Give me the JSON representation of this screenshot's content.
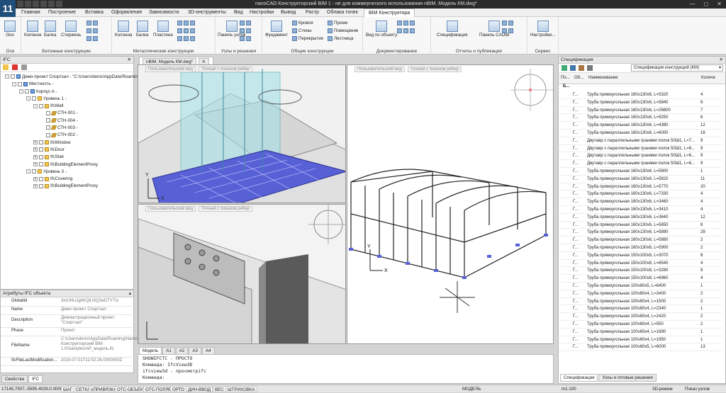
{
  "app_title": "nanoCAD Конструкторский BIM 1 - не для коммерческого использования nBIM. Модель КМ.dwg*",
  "logo": "11",
  "menu": [
    "Главная",
    "Построение",
    "Вставка",
    "Оформление",
    "Зависимости",
    "3D-инструменты",
    "Вид",
    "Настройки",
    "Вывод",
    "Растр",
    "Облака точек",
    "BIM Конструктора"
  ],
  "ribbon": {
    "groups": [
      {
        "label": "Оси",
        "buttons": [
          "Оси"
        ]
      },
      {
        "label": "Бетонные конструкции",
        "buttons": [
          "Колонна",
          "Балка",
          "Стержень"
        ]
      },
      {
        "label": "Металлические конструкции",
        "buttons": [
          "Колонна",
          "Балка",
          "Пластина"
        ]
      },
      {
        "label": "Узлы и решения",
        "buttons": [
          "Панель узлов"
        ]
      },
      {
        "label": "Общие конструкции",
        "buttons": [
          "Фундамент",
          "Кровля",
          "Стены",
          "Перекрытие",
          "Проем",
          "Помещение",
          "Лестница"
        ]
      },
      {
        "label": "Документирование",
        "buttons": [
          "Вид по объекту"
        ]
      },
      {
        "label": "Отчеты и публикация",
        "buttons": [
          "Спецификация",
          "Панель CADlib"
        ]
      },
      {
        "label": "Сервис",
        "buttons": [
          "Настройки..."
        ]
      }
    ]
  },
  "ifc_panel": {
    "title": "IFC",
    "tree": [
      "Демо-проект Спортзал - \"C:\\Users\\denis\\AppData\\Roamin",
      "Местность -",
      "Корпус А -",
      "Уровень 1 -",
      "IfcWall",
      "СТН-001 -",
      "СТН-004 -",
      "СТН-003 -",
      "СТН-002 -",
      "IfcWindow",
      "IfcDoor",
      "IfcStair",
      "IfcBuildingElementProxy",
      "Уровень 3 -",
      "IfcCovering",
      "IfcBuildingElementProxy"
    ]
  },
  "attributes": {
    "title": "Атрибуты IFC объекта",
    "rows": [
      {
        "k": "GlobalId",
        "v": "3mUNUJghKQlU3Q3wDTYTIv"
      },
      {
        "k": "Name",
        "v": "Демо-проект Спортзал"
      },
      {
        "k": "Description",
        "v": "Демонстрационный проект \"Спортзал\""
      },
      {
        "k": "Phase",
        "v": "Проект"
      },
      {
        "k": "FileName",
        "v": "C:\\Users\\denis\\AppData\\Roaming\\Nanosoft\\nanoCAD Конструкторский BIM 1.0\\Samples\\AP_модель.ifc"
      },
      {
        "k": "IfcFileLastModification...",
        "v": "2019-07-01T12:52:26.0000000Z"
      }
    ]
  },
  "left_tabs": [
    "Свойства",
    "IFC"
  ],
  "doc_tab": "nBIM. Модель КМ.dwg*",
  "viewport_labels": [
    "Пользовательский вид",
    "Точный с показом ребер"
  ],
  "model_tabs": [
    "Модель",
    "A1",
    "A2",
    "A3",
    "A4"
  ],
  "command_lines": [
    "SHOWIFCTC - ПРОСТО",
    "Команда: IfcView3D",
    "ifcview3d - просмотрifc",
    "Команда:"
  ],
  "spec_panel": {
    "title": "Спецификация",
    "dropdown": "Спецификация конструкций (КМ)",
    "headers": [
      "По...",
      "Об...",
      "Наименование",
      "Количе"
    ],
    "group_row": "Б...",
    "rows": [
      {
        "c": "Г...",
        "n": "Труба прямоугольная 160х130х6, L=5320",
        "q": "4"
      },
      {
        "c": "Г...",
        "n": "Труба прямоугольная 160х130х6, L=5840",
        "q": "6"
      },
      {
        "c": "Г...",
        "n": "Труба прямоугольная 160х130х6, L=26800",
        "q": "7"
      },
      {
        "c": "Г...",
        "n": "Труба прямоугольная 160х130х6, L=9250",
        "q": "6"
      },
      {
        "c": "Г...",
        "n": "Труба прямоугольная 160х130х6, L=4380",
        "q": "12"
      },
      {
        "c": "Г...",
        "n": "Труба прямоугольная 160х130х6, L=6000",
        "q": "16"
      },
      {
        "c": "Г...",
        "n": "Двутавр с параллельными гранями полок 50Ш1, L=7...",
        "q": "9"
      },
      {
        "c": "Г...",
        "n": "Двутавр с параллельными гранями полок 50Ш1, L=6...",
        "q": "9"
      },
      {
        "c": "Г...",
        "n": "Двутавр с параллельными гранями полок 50Ш1, L=6...",
        "q": "9"
      },
      {
        "c": "Г...",
        "n": "Двутавр с параллельными гранями полок 50Ш1, L=6...",
        "q": "9"
      },
      {
        "c": "Г...",
        "n": "Труба прямоугольная 160х130х6, L=5800",
        "q": "1"
      },
      {
        "c": "Г...",
        "n": "Труба прямоугольная 160х130х6, L=5820",
        "q": "11"
      },
      {
        "c": "Г...",
        "n": "Труба прямоугольная 160х130х6, L=5770",
        "q": "20"
      },
      {
        "c": "Г...",
        "n": "Труба прямоугольная 160х130х6, L=7330",
        "q": "4"
      },
      {
        "c": "Г...",
        "n": "Труба прямоугольная 160х130х6, L=3460",
        "q": "4"
      },
      {
        "c": "Г...",
        "n": "Труба прямоугольная 160х130х6, L=3410",
        "q": "4"
      },
      {
        "c": "Г...",
        "n": "Труба прямоугольная 160х130х6, L=3640",
        "q": "12"
      },
      {
        "c": "Г...",
        "n": "Труба прямоугольная 160х130х6, L=5850",
        "q": "8"
      },
      {
        "c": "Г...",
        "n": "Труба прямоугольная 160х130х6, L=5890",
        "q": "28"
      },
      {
        "c": "Г...",
        "n": "Труба прямоугольная 160х130х6, L=5880",
        "q": "2"
      },
      {
        "c": "Г...",
        "n": "Труба прямоугольная 160х130х6, L=5900",
        "q": "2"
      },
      {
        "c": "Г...",
        "n": "Труба прямоугольная 150х100х8, L=3070",
        "q": "8"
      },
      {
        "c": "Г...",
        "n": "Труба прямоугольная 150х100х8, L=6540",
        "q": "4"
      },
      {
        "c": "Г...",
        "n": "Труба прямоугольная 150х100х8, L=3280",
        "q": "8"
      },
      {
        "c": "Г...",
        "n": "Труба прямоугольная 150х100х8, L=6960",
        "q": "4"
      },
      {
        "c": "Г...",
        "n": "Труба прямоугольная 100х60х5, L=6400",
        "q": "1"
      },
      {
        "c": "Г...",
        "n": "Труба прямоугольная 100х60х4, L=3400",
        "q": "2"
      },
      {
        "c": "Г...",
        "n": "Труба прямоугольная 100х60х4, L=1500",
        "q": "2"
      },
      {
        "c": "Г...",
        "n": "Труба прямоугольная 100х60х4, L=2340",
        "q": "1"
      },
      {
        "c": "Г...",
        "n": "Труба прямоугольная 100х60х4, L=2420",
        "q": "2"
      },
      {
        "c": "Г...",
        "n": "Труба прямоугольная 100х60х4, L=550",
        "q": "2"
      },
      {
        "c": "Г...",
        "n": "Труба прямоугольная 100х60х4, L=1690",
        "q": "1"
      },
      {
        "c": "Г...",
        "n": "Труба прямоугольная 100х60х4, L=1950",
        "q": "1"
      },
      {
        "c": "Г...",
        "n": "Труба прямоугольная 100х60х5, L=6000",
        "q": "13"
      }
    ],
    "tabs": [
      "Спецификация",
      "Узлы и готовые решения"
    ]
  },
  "status": {
    "coords": "17145.7507,-5595.4029,0.0000",
    "toggles": [
      "ШАГ",
      "СЕТКА",
      "оПРИВЯЗКА",
      "ОТС-ОБЪЕКТ",
      "ОТС-ПОЛЯР",
      "ОРТО",
      "ДИН-ВВОД",
      "ВЕС",
      "ШТРИХОВКА"
    ],
    "model": "МОДЕЛЬ",
    "scale": "m1:100",
    "mode": "3D-режим",
    "nodes": "Показ узлов"
  },
  "colors": {
    "accent": "#1f4e79",
    "ribbon_tab": "#ffffff",
    "model_grid": "#5860d6",
    "glass": "#7fd3d9"
  }
}
